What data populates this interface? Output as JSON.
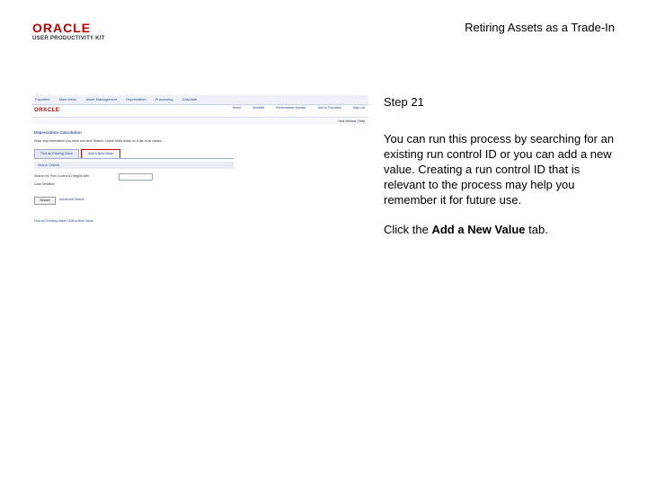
{
  "header": {
    "logo_brand": "ORACLE",
    "logo_sub": "USER PRODUCTIVITY KIT",
    "title": "Retiring Assets as a Trade-In"
  },
  "screenshot": {
    "nav": [
      "Favorites",
      "Main Menu",
      "Asset Management",
      "Depreciation",
      "Processing",
      "Calculate"
    ],
    "brand": "ORACLE",
    "top_menu": [
      "Home",
      "Worklist",
      "Performance Monitor",
      "Add to Favorites",
      "Sign out"
    ],
    "links": "New Window | Help",
    "page_title": "Depreciation Calculation",
    "instructions": "Enter any information you have and click Search. Leave fields blank for a list of all values.",
    "tabs": {
      "find": "Find an Existing Value",
      "add": "Add a New Value"
    },
    "criteria": "Search Criteria",
    "search_by_label": "Search by:",
    "search_by_value": "Run Control ID begins with",
    "case_sensitive": "Case Sensitive",
    "search_button": "Search",
    "advanced": "Advanced Search",
    "footer": "Find an Existing Value | Add a New Value"
  },
  "panel": {
    "step": "Step 21",
    "body": "You can run this process by searching for an existing run control ID or you can add a new value. Creating a run control ID that is relevant to the process may help you remember it for future use.",
    "instruction_prefix": "Click the ",
    "instruction_target": "Add a New Value",
    "instruction_suffix": " tab."
  }
}
